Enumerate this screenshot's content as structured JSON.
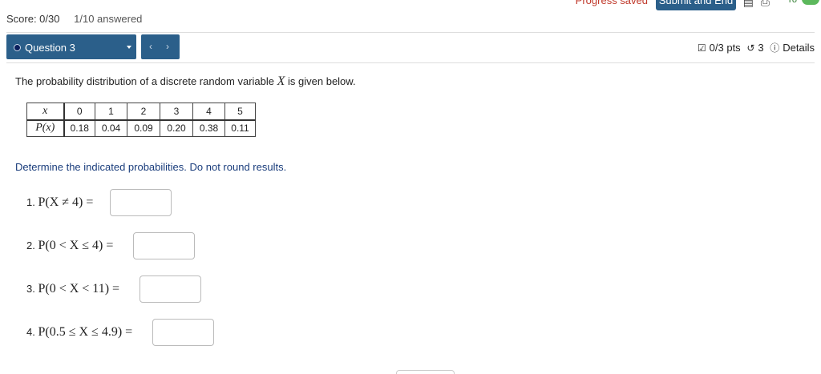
{
  "header": {
    "progress_saved": "Progress saved",
    "submit_label": "Submit and End",
    "toggle_label": "Yo"
  },
  "score": {
    "score_text": "Score: 0/30",
    "answered_text": "1/10 answered"
  },
  "question_nav": {
    "current_label": "Question 3",
    "prev_symbol": "‹",
    "next_symbol": "›"
  },
  "meta": {
    "points": "0/3 pts",
    "attempts": "3",
    "details_label": "Details"
  },
  "prompt": {
    "before": "The probability distribution of a discrete random variable ",
    "variable": "X",
    "after": " is given below."
  },
  "table": {
    "row_headers": [
      "x",
      "P(x)"
    ],
    "x_values": [
      "0",
      "1",
      "2",
      "3",
      "4",
      "5"
    ],
    "p_values": [
      "0.18",
      "0.04",
      "0.09",
      "0.20",
      "0.38",
      "0.11"
    ]
  },
  "instruction": "Determine the indicated probabilities. Do not round results.",
  "questions": [
    {
      "number": "1.",
      "expression": "P(X ≠ 4) =",
      "answer": ""
    },
    {
      "number": "2.",
      "expression": "P(0 < X ≤ 4) =",
      "answer": ""
    },
    {
      "number": "3.",
      "expression": "P(0 < X < 11) =",
      "answer": ""
    },
    {
      "number": "4.",
      "expression": "P(0.5 ≤ X ≤ 4.9) =",
      "answer": ""
    }
  ],
  "colors": {
    "accent": "#2b5f8a",
    "alert": "#c0392b",
    "instruction": "#1a3d7c",
    "toggle_on": "#5cb85c"
  }
}
